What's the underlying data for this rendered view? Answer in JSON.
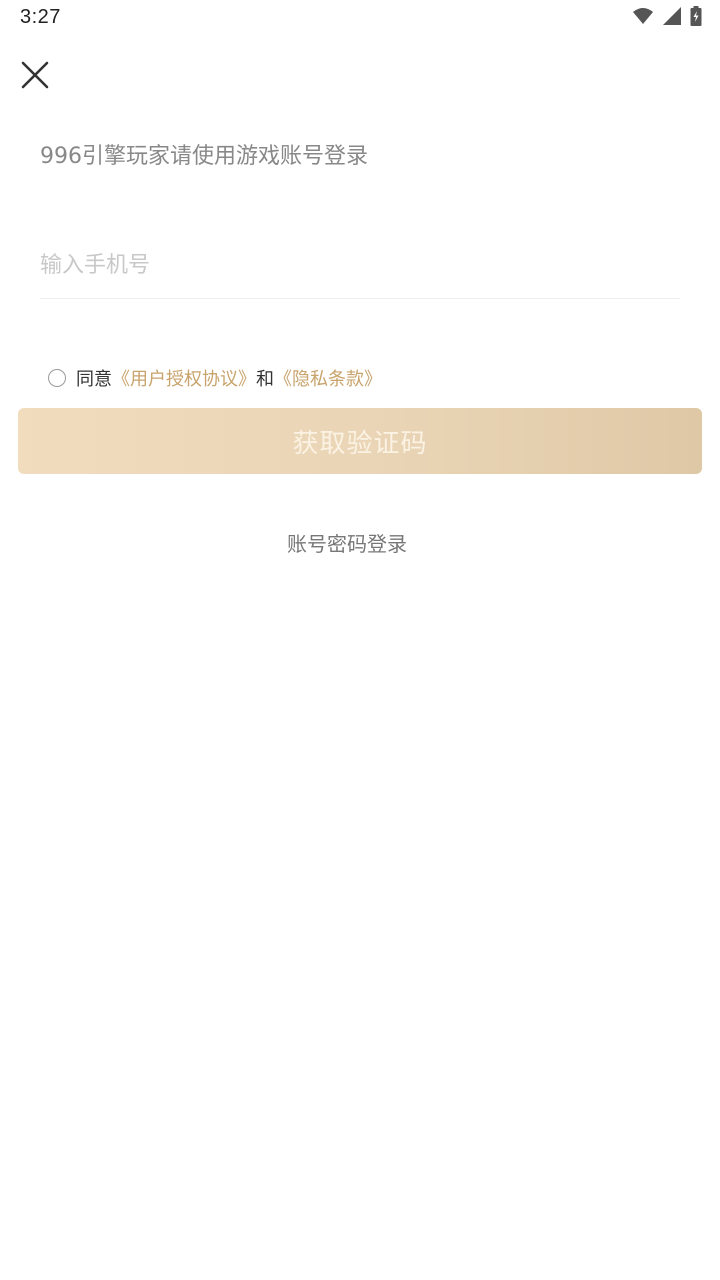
{
  "status_bar": {
    "time": "3:27",
    "icons": [
      "wifi-icon",
      "signal-icon",
      "battery-charging-icon"
    ]
  },
  "header": {
    "close_icon": "close-icon"
  },
  "main": {
    "headline": "996引擎玩家请使用游戏账号登录",
    "phone_input": {
      "placeholder": "输入手机号",
      "value": ""
    },
    "agreement": {
      "checked": false,
      "prefix": "同意",
      "user_agreement_link": "《用户授权协议》",
      "conjunction": "和",
      "privacy_link": "《隐私条款》"
    },
    "get_code_button": "获取验证码",
    "password_login_link": "账号密码登录"
  },
  "colors": {
    "accent": "#c8a36b",
    "button_gradient_start": "#f1dcbd",
    "button_gradient_end": "#dfc8a6",
    "button_text": "#fbf2e4"
  }
}
